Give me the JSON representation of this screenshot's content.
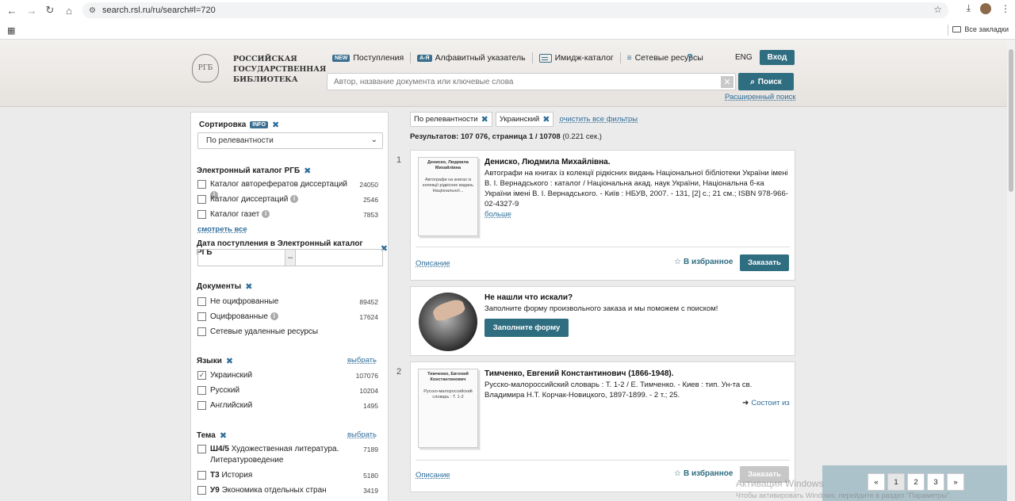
{
  "browser": {
    "url": "search.rsl.ru/ru/search#l=720",
    "all_bookmarks": "Все закладки"
  },
  "header": {
    "logo_line1": "РОССИЙСКАЯ",
    "logo_line2": "ГОСУДАРСТВЕННАЯ",
    "logo_line3": "БИБЛИОТЕКА",
    "nav": [
      {
        "badge": "NEW",
        "label": "Поступления"
      },
      {
        "badge": "А-Я",
        "label": "Алфавитный указатель"
      },
      {
        "label": "Имидж-каталог"
      },
      {
        "label": "Сетевые ресурсы"
      }
    ],
    "help": "?",
    "lang": "ENG",
    "login": "Вход",
    "search_placeholder": "Автор, название документа или ключевые слова",
    "search_button": "Поиск",
    "advanced_search": "Расширенный поиск"
  },
  "sidebar": {
    "sort": {
      "title": "Сортировка",
      "info": "INFO",
      "selected": "По релевантности"
    },
    "catalog": {
      "title": "Электронный каталог РГБ",
      "items": [
        {
          "label": "Каталог авторефератов диссертаций",
          "count": "24050"
        },
        {
          "label": "Каталог диссертаций",
          "count": "2546"
        },
        {
          "label": "Каталог газет",
          "count": "7853"
        }
      ],
      "see_all": "смотреть все"
    },
    "date": {
      "title": "Дата поступления в Электронный каталог РГБ",
      "dash": "–"
    },
    "documents": {
      "title": "Документы",
      "items": [
        {
          "label": "Не оцифрованные",
          "count": "89452"
        },
        {
          "label": "Оцифрованные",
          "count": "17624"
        },
        {
          "label": "Сетевые удаленные ресурсы",
          "count": ""
        }
      ]
    },
    "languages": {
      "title": "Языки",
      "choose": "выбрать",
      "items": [
        {
          "label": "Украинский",
          "count": "107076",
          "checked": true
        },
        {
          "label": "Русский",
          "count": "10204"
        },
        {
          "label": "Английский",
          "count": "1495"
        }
      ]
    },
    "theme": {
      "title": "Тема",
      "choose": "выбрать",
      "items": [
        {
          "code": "Ш4/5",
          "label": "Художественная литература. Литературоведение",
          "count": "7189"
        },
        {
          "code": "Т3",
          "label": "История",
          "count": "5180"
        },
        {
          "code": "У9",
          "label": "Экономика отдельных стран",
          "count": "3419"
        }
      ]
    }
  },
  "results": {
    "filters": [
      "По релевантности",
      "Украинский"
    ],
    "clear_filters": "очистить все фильтры",
    "summary_label": "Результатов: 107 076, страница 1 / 10708",
    "summary_time": "(0.221 сек.)",
    "records": [
      {
        "num": "1",
        "cover_author": "Дениско, Людмила Михайлівна",
        "cover_title": "Автографи на книгах із колекції рідкісних видань Національної...",
        "title": "Дениско, Людмила Михайлівна.",
        "description": "Автографи на книгах із колекції рідкісних видань Національної бібліотеки України імені В. І. Вернадського : каталог / Національна акад. наук України, Національна б-ка України імені В. І. Вернадського. - Київ : НБУВ, 2007. - 131, [2] с.; 21 см.; ISBN 978-966-02-4327-9",
        "more": "больше",
        "desc_link": "Описание",
        "favorite": "В избранное",
        "order": "Заказать"
      },
      {
        "num": "2",
        "cover_author": "Тимченко, Евгений Константинович",
        "cover_title": "Русско-малороссийский словарь : Т. 1-2",
        "title": "Тимченко, Евгений Константинович (1866-1948).",
        "description": "Русско-малороссийский словарь : Т. 1-2 / Е. Тимченко. - Киев : тип. Ун-та св. Владимира Н.Т. Корчак-Новицкого, 1897-1899. - 2 т.; 25.",
        "consists": "Состоит из",
        "desc_link": "Описание",
        "favorite": "В избранное",
        "order": "Заказать"
      }
    ],
    "promo": {
      "title": "Не нашли что искали?",
      "text": "Заполните форму произвольного заказа и мы поможем с поиском!",
      "button": "Заполните форму"
    }
  },
  "pagination": {
    "prev": "«",
    "pages": [
      "1",
      "2",
      "3"
    ],
    "next": "»",
    "current": "1"
  },
  "watermark": {
    "line1": "Активация Windows",
    "line2": "Чтобы активировать Windows, перейдите в раздел \"Параметры\"."
  }
}
